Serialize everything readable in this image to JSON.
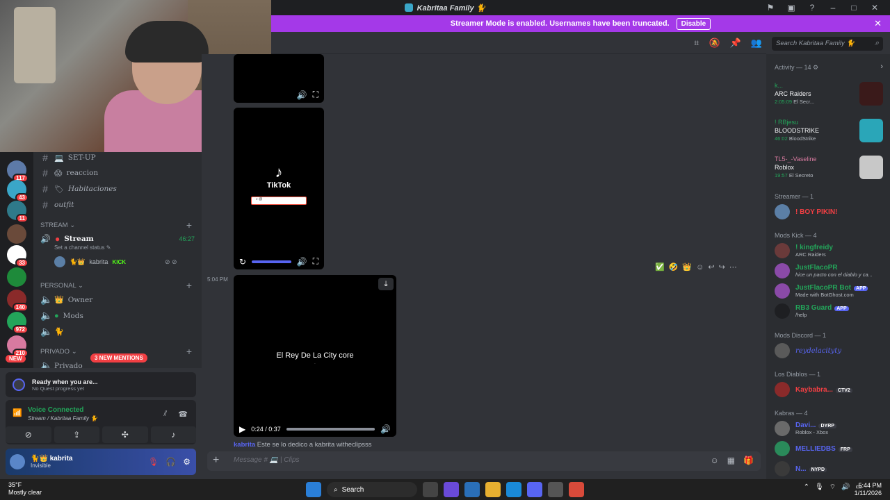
{
  "window": {
    "title": "Kabritaa Family 🐈",
    "controls": [
      "flag-icon",
      "screen-icon",
      "help-icon",
      "minimize-icon",
      "maximize-icon",
      "close-icon"
    ]
  },
  "banner": {
    "text": "Streamer Mode is enabled. Usernames have been truncated.",
    "button": "Disable"
  },
  "search": {
    "placeholder": "Search Kabritaa Family 🐈"
  },
  "guilds": [
    {
      "badge": "117",
      "color": "#5d7aa8"
    },
    {
      "badge": "43",
      "color": "#3aa6c8"
    },
    {
      "badge": "11",
      "color": "#2f7a8a"
    },
    {
      "badge": "",
      "color": "#6a4a3a"
    },
    {
      "badge": "33",
      "color": "#ffffff"
    },
    {
      "badge": "",
      "color": "#1e8a3a"
    },
    {
      "badge": "140",
      "color": "#8a2a2a"
    },
    {
      "badge": "972",
      "color": "#23a55a"
    },
    {
      "badge": "210",
      "color": "#d87aa0"
    }
  ],
  "new_pill": "NEW",
  "channels": {
    "items": [
      {
        "icon": "#",
        "emoji": "💻",
        "name": "SET-UP"
      },
      {
        "icon": "#",
        "emoji": "😱",
        "name": "reaccion"
      },
      {
        "icon": "#",
        "emoji": "🏷",
        "name": "Habitaciones"
      },
      {
        "icon": "#",
        "emoji": "",
        "name": "outfit"
      }
    ],
    "category_stream": "STREAM",
    "stream_channel": "Stream",
    "stream_time": "46:27",
    "stream_status": "Set a channel status",
    "stream_user": "kabrita",
    "stream_user_tag": "KICK",
    "category_personal": "PERSONAL",
    "personal_items": [
      "Owner",
      "Mods",
      ""
    ],
    "category_privado": "PRIVADO",
    "privado_item": "Privado",
    "mentions": "3 NEW MENTIONS"
  },
  "quest": {
    "title": "Ready when you are...",
    "subtitle": "No Quest progress yet"
  },
  "voice": {
    "status": "Voice Connected",
    "channel": "Stream / Kabritaa Family 🐈"
  },
  "user": {
    "name": "kabrita",
    "status": "Invisible"
  },
  "chat": {
    "media1_controls": "",
    "tiktok_word": "TikTok",
    "timestamp": "5:04 PM",
    "video_title": "El Rey De La City core",
    "video_time": "0:24 / 0:37",
    "last_message_user": "kabrita",
    "last_message_text": "Este se lo dedico a kabrita  witheclipsss"
  },
  "composer": {
    "placeholder": "Message # 💻 | Clips"
  },
  "members": {
    "activity_header": "Activity — 14",
    "activities": [
      {
        "user": "k...",
        "game": "ARC Raiders",
        "time": "2:05:09",
        "detail": "El Secr...",
        "thumb": "#3a1a1a"
      },
      {
        "user": "! RBjesu",
        "game": "BLOODSTRIKE",
        "time": "46:02",
        "detail": "BloodStrike",
        "thumb": "#2aa6b8"
      },
      {
        "user": "TL5-_-Vaseline",
        "game": "Roblox",
        "time": "19:57",
        "detail": "El Secreto",
        "thumb": "#c8c8c8"
      }
    ],
    "streamer_header": "Streamer — 1",
    "streamer": {
      "name": "! BOY PIKIN!",
      "color": "#f23f43"
    },
    "modskick_header": "Mods Kick — 4",
    "modskick": [
      {
        "name": "! kingfreidy",
        "sub": "ARC Raiders",
        "color": "#23a55a",
        "tag": ""
      },
      {
        "name": "JustFlacoPR",
        "sub": "hice un pacto con el diablo y ca...",
        "color": "#23a55a",
        "tag": ""
      },
      {
        "name": "JustFlacoPR Bot",
        "sub": "Made with BotGhost.com",
        "color": "#23a55a",
        "tag": "APP"
      },
      {
        "name": "RB3 Guard",
        "sub": "/help",
        "color": "#23a55a",
        "tag": "APP"
      }
    ],
    "modsdiscord_header": "Mods Discord — 1",
    "modsdiscord": {
      "name": "reydelacityty",
      "color": "#5865f2"
    },
    "diablos_header": "Los Diablos — 1",
    "diablos": {
      "name": "Kaybabra...",
      "color": "#f23f43",
      "tag": "CTV2"
    },
    "kabras_header": "Kabras — 4",
    "kabras": [
      {
        "name": "Davi...",
        "sub": "Roblox - Xbox",
        "color": "#5865f2",
        "tag": "DYRP"
      },
      {
        "name": "MELLIEDBS",
        "sub": "",
        "color": "#5865f2",
        "tag": "FRP"
      },
      {
        "name": "N...",
        "sub": "",
        "color": "#5865f2",
        "tag": "NYPD"
      }
    ]
  },
  "taskbar": {
    "temp": "35°F",
    "weather": "Mostly clear",
    "search": "Search",
    "time": "5:44 PM",
    "date": "1/11/2026"
  }
}
